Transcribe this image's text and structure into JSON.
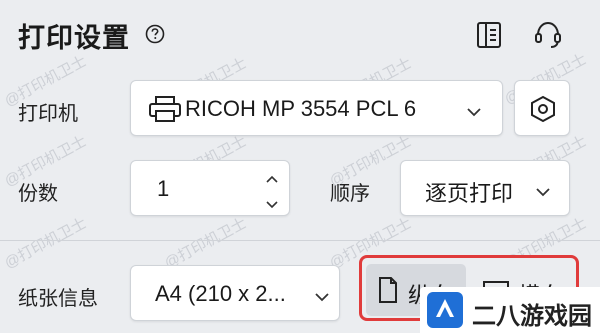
{
  "header": {
    "title": "打印设置",
    "help_icon": "question-circle-icon",
    "panel_icon": "panel-layout-icon",
    "support_icon": "headset-icon"
  },
  "watermark_text": "@打印机卫士",
  "printer": {
    "label": "打印机",
    "value": "RICOH MP 3554 PCL 6",
    "icon": "printer-icon",
    "settings_icon": "hexagon-settings-icon"
  },
  "copies": {
    "label": "份数",
    "value": "1"
  },
  "order": {
    "label": "顺序",
    "value": "逐页打印"
  },
  "paper": {
    "label": "纸张信息",
    "value": "A4 (210 x 2..."
  },
  "orientation": {
    "portrait_label": "纵向",
    "landscape_label": "横向",
    "selected": "portrait"
  },
  "logo": {
    "text": "二八游戏园"
  },
  "colors": {
    "background": "#ebedf0",
    "highlight_border": "#e03b3b",
    "logo_blue": "#1f6fd6"
  }
}
